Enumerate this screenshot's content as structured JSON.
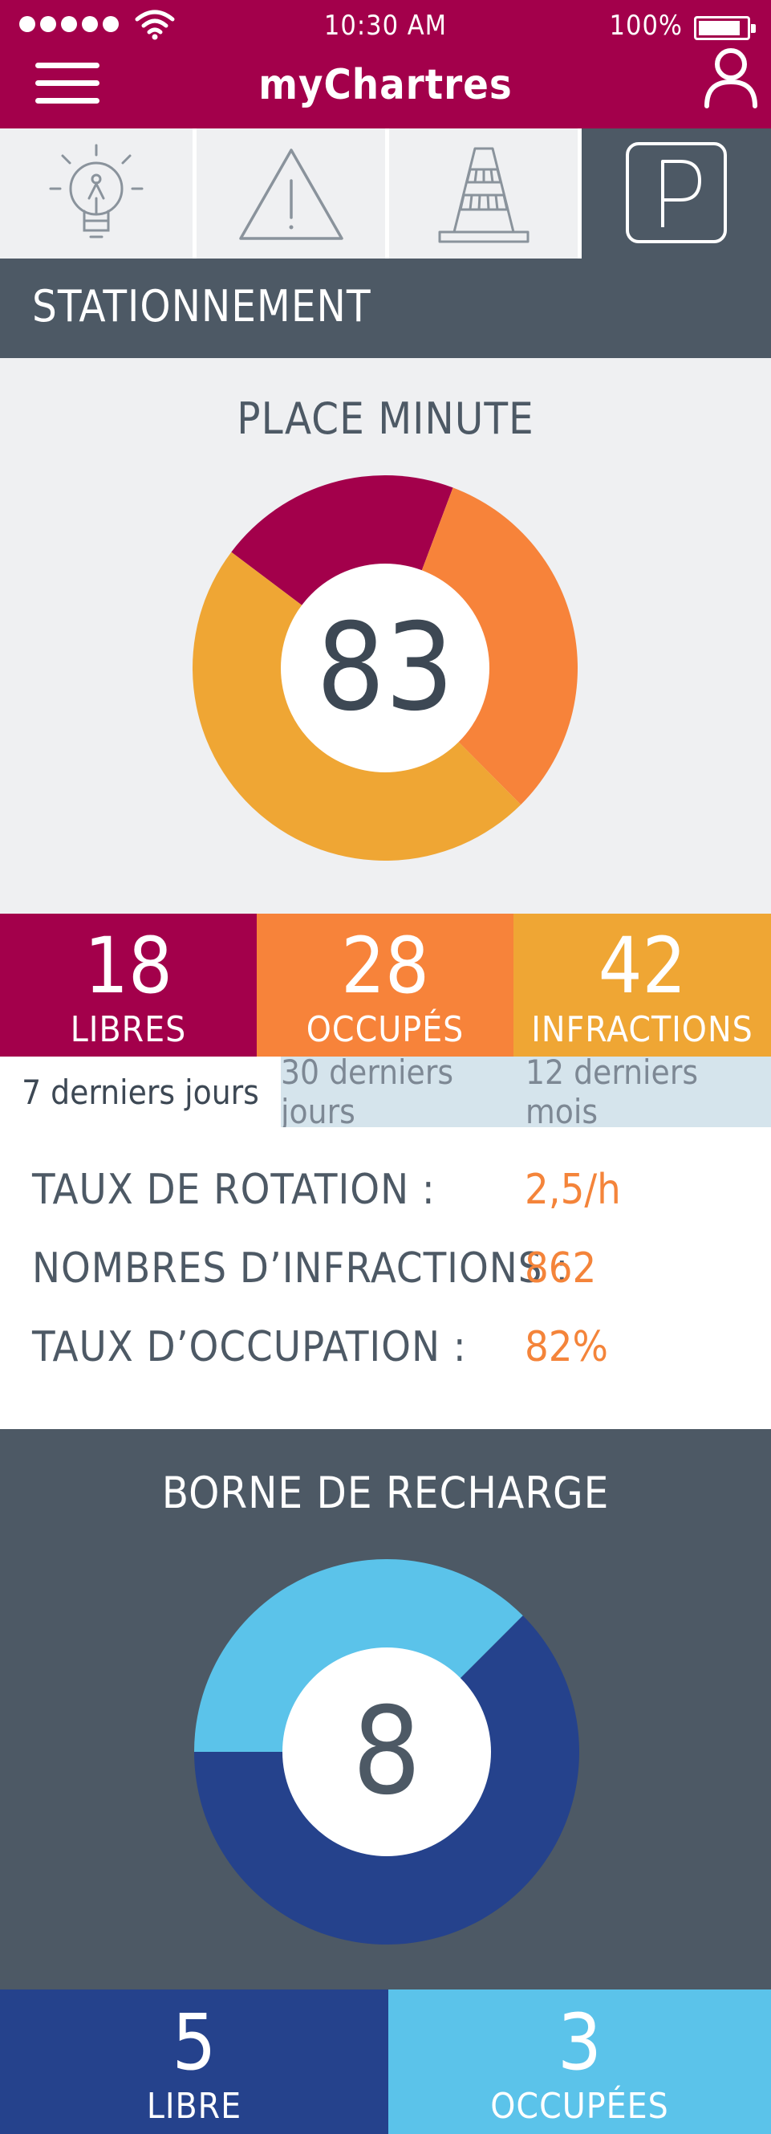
{
  "status": {
    "time": "10:30 AM",
    "battery": "100%"
  },
  "header": {
    "title": "myChartres"
  },
  "tabs": [
    {
      "icon": "lightbulb-icon"
    },
    {
      "icon": "warning-icon"
    },
    {
      "icon": "traffic-cone-icon"
    },
    {
      "icon": "parking-icon"
    }
  ],
  "section": {
    "title": "STATIONNEMENT"
  },
  "place": {
    "title": "PLACE MINUTE",
    "total": "83",
    "stats": [
      {
        "value": "18",
        "label": "LIBRES",
        "color": "#a3004b"
      },
      {
        "value": "28",
        "label": "OCCUPÉS",
        "color": "#f7833a"
      },
      {
        "value": "42",
        "label": "INFRACTIONS",
        "color": "#efa634"
      }
    ]
  },
  "periods": [
    {
      "label": "7 derniers jours",
      "active": true
    },
    {
      "label": "30 derniers jours",
      "active": false
    },
    {
      "label": "12 derniers mois",
      "active": false
    }
  ],
  "metrics": [
    {
      "label": "TAUX DE ROTATION :",
      "value": "2,5/h"
    },
    {
      "label": "NOMBRES D’INFRACTIONS :",
      "value": "862"
    },
    {
      "label": "TAUX D’OCCUPATION :",
      "value": "82%"
    }
  ],
  "borne": {
    "title": "BORNE DE RECHARGE",
    "total": "8",
    "stats": [
      {
        "value": "5",
        "label": "LIBRE",
        "color": "#25428c"
      },
      {
        "value": "3",
        "label": "OCCUPÉES",
        "color": "#5bc3ea"
      }
    ]
  },
  "chart_data": [
    {
      "type": "pie",
      "categories": [
        "LIBRES",
        "OCCUPÉS",
        "INFRACTIONS"
      ],
      "values": [
        18,
        28,
        42
      ],
      "colors": [
        "#a3004b",
        "#f7833a",
        "#efa634"
      ]
    },
    {
      "type": "pie",
      "categories": [
        "LIBRE",
        "OCCUPÉES"
      ],
      "values": [
        5,
        3
      ],
      "colors": [
        "#25428c",
        "#5bc3ea"
      ]
    }
  ]
}
